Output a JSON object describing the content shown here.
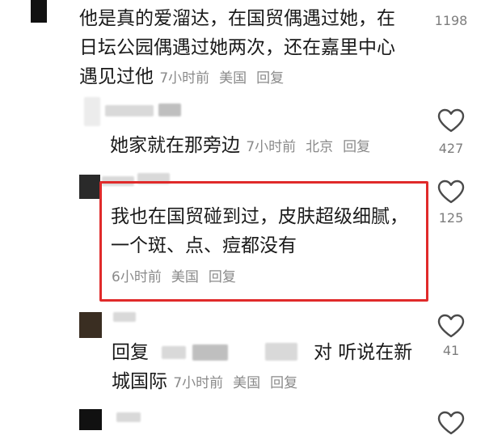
{
  "comments": [
    {
      "text": "他是真的爱溜达，在国贸偶遇过她，在日坛公园偶遇过她两次，还在嘉里中心遇见过他",
      "line1": "他是真的爱溜达，在国贸偶遇过她，在",
      "line2": "日坛公园偶遇过她两次，还在嘉里中心",
      "line3_text": "遇见过他",
      "time": "7小时前",
      "location": "美国",
      "reply_label": "回复",
      "likes": "1198"
    },
    {
      "text": "她家就在那旁边",
      "time": "7小时前",
      "location": "北京",
      "reply_label": "回复",
      "likes": "427"
    },
    {
      "line1": "我也在国贸碰到过，皮肤超级细腻，",
      "line2": "一个斑、点、痘都没有",
      "time": "6小时前",
      "location": "美国",
      "reply_label": "回复",
      "likes": "125"
    },
    {
      "reply_prefix": "回复",
      "line1_tail": "对 听说在新",
      "line2_text": "城国际",
      "time": "7小时前",
      "location": "美国",
      "reply_label": "回复",
      "likes": "41"
    }
  ],
  "colors": {
    "highlight": "#e02a2a",
    "meta": "#8a8a8a",
    "text": "#1a1a1a"
  },
  "icons": {
    "like": "heart-outline-icon"
  }
}
